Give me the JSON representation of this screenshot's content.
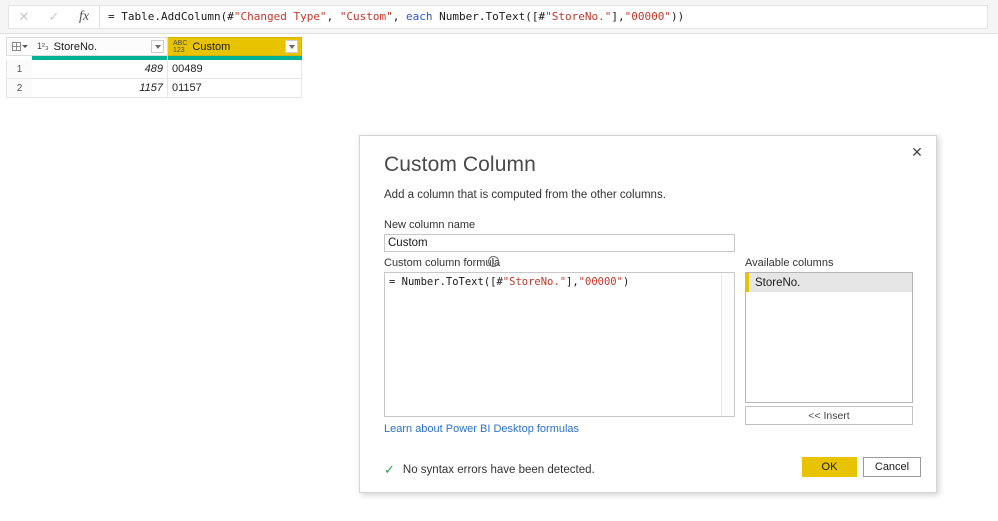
{
  "formula_bar": {
    "cancel_icon": "close-icon",
    "accept_icon": "checkmark-icon",
    "function_icon": "fx-icon",
    "formula_segments": [
      {
        "text": "= Table.AddColumn(#",
        "kind": "plain"
      },
      {
        "text": "\"Changed Type\"",
        "kind": "string"
      },
      {
        "text": ", ",
        "kind": "plain"
      },
      {
        "text": "\"Custom\"",
        "kind": "string"
      },
      {
        "text": ", ",
        "kind": "plain"
      },
      {
        "text": "each",
        "kind": "keyword"
      },
      {
        "text": " Number.ToText([#",
        "kind": "plain"
      },
      {
        "text": "\"StoreNo.\"",
        "kind": "string"
      },
      {
        "text": "],",
        "kind": "plain"
      },
      {
        "text": "\"00000\"",
        "kind": "string"
      },
      {
        "text": "))",
        "kind": "plain"
      }
    ],
    "formula_plain": "= Table.AddColumn(#\"Changed Type\", \"Custom\", each Number.ToText([#\"StoreNo.\"],\"00000\"))"
  },
  "grid": {
    "corner_icon": "select-all-table-icon",
    "columns": [
      {
        "name": "StoreNo.",
        "type_icon": "number-type-icon",
        "type_glyph": "1²₃",
        "selected": false
      },
      {
        "name": "Custom",
        "type_icon": "text-type-icon",
        "type_glyph": "ABC\n123",
        "selected": true
      }
    ],
    "rows": [
      {
        "index": "1",
        "store_no": "489",
        "custom": "00489"
      },
      {
        "index": "2",
        "store_no": "1157",
        "custom": "01157"
      }
    ],
    "quality_bar_color": "#00b294",
    "selected_column_color": "#e8c300"
  },
  "dialog": {
    "title": "Custom Column",
    "subtitle": "Add a column that is computed from the other columns.",
    "close_icon": "close-icon",
    "new_column_name_label": "New column name",
    "new_column_name_value": "Custom",
    "new_column_name_placeholder": "Custom",
    "formula_label": "Custom column formula",
    "formula_info_icon": "info-icon",
    "formula_segments": [
      {
        "text": "= Number.ToText([#",
        "kind": "plain"
      },
      {
        "text": "\"StoreNo.\"",
        "kind": "string"
      },
      {
        "text": "],",
        "kind": "plain"
      },
      {
        "text": "\"00000\"",
        "kind": "string"
      },
      {
        "text": ")",
        "kind": "plain"
      }
    ],
    "formula_plain": "= Number.ToText([#\"StoreNo.\"],\"00000\")",
    "available_columns_label": "Available columns",
    "available_columns": [
      "StoreNo."
    ],
    "insert_label": "<< Insert",
    "learn_link": "Learn about Power BI Desktop formulas",
    "status_icon": "checkmark-icon",
    "status_text": "No syntax errors have been detected.",
    "ok_label": "OK",
    "cancel_label": "Cancel",
    "accent_color": "#e8c300",
    "status_color": "#2e9e4f",
    "link_color": "#2a72c8"
  }
}
